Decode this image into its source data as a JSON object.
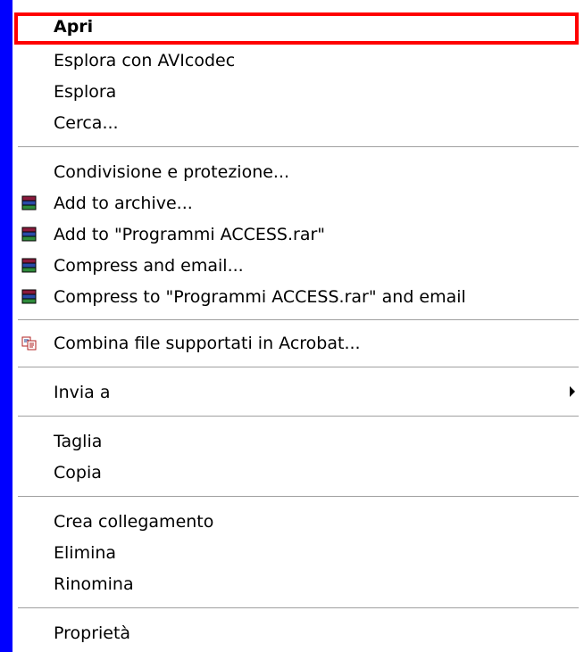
{
  "menu": {
    "items": {
      "open": "Apri",
      "explore_avicodec": "Esplora con AVIcodec",
      "explore": "Esplora",
      "search": "Cerca...",
      "sharing": "Condivisione e protezione...",
      "add_archive": "Add to archive...",
      "add_rar": "Add to \"Programmi ACCESS.rar\"",
      "compress_email": "Compress and email...",
      "compress_rar_email": "Compress to \"Programmi ACCESS.rar\" and email",
      "combine_acrobat": "Combina file supportati in Acrobat...",
      "send_to": "Invia a",
      "cut": "Taglia",
      "copy": "Copia",
      "create_shortcut": "Crea collegamento",
      "delete": "Elimina",
      "rename": "Rinomina",
      "properties": "Proprietà"
    },
    "icons": {
      "winrar": "winrar-icon",
      "acrobat": "acrobat-combine-icon",
      "submenu": "submenu-arrow-icon"
    },
    "colors": {
      "background": "#0000ff",
      "menu": "#ffffff",
      "highlight_border": "#ff0000"
    }
  }
}
